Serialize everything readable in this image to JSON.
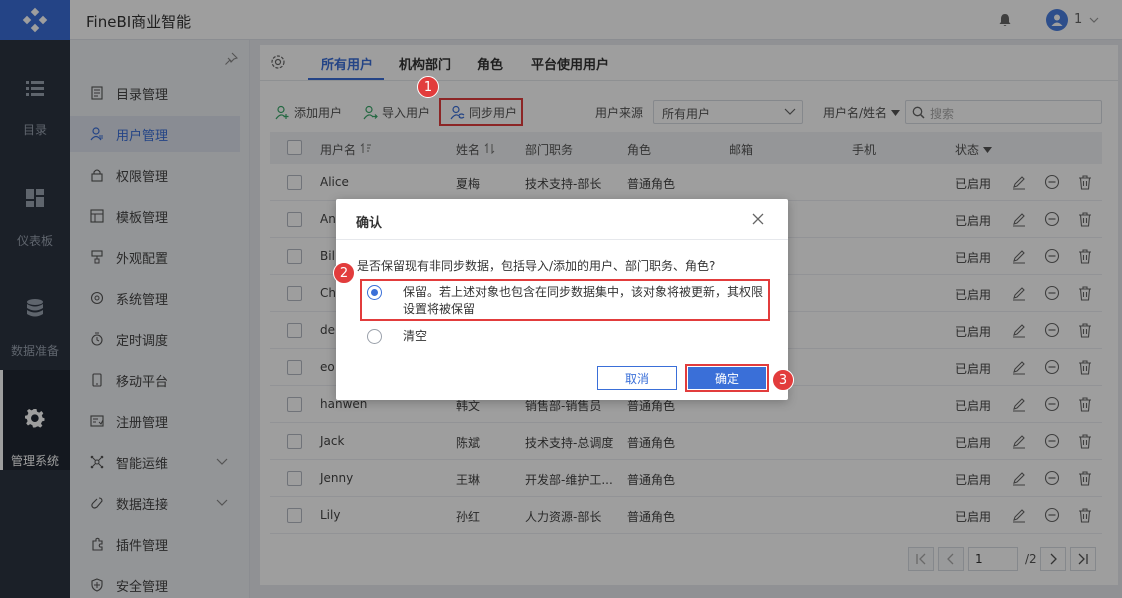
{
  "app": {
    "title": "FineBI商业智能",
    "user_name": "1"
  },
  "rail": [
    {
      "label": "目录",
      "icon": "list-icon"
    },
    {
      "label": "仪表板",
      "icon": "dashboard-icon"
    },
    {
      "label": "数据准备",
      "icon": "database-icon"
    },
    {
      "label": "管理系统",
      "icon": "gear-icon",
      "active": true
    }
  ],
  "menu": [
    {
      "label": "目录管理"
    },
    {
      "label": "用户管理",
      "active": true
    },
    {
      "label": "权限管理"
    },
    {
      "label": "模板管理"
    },
    {
      "label": "外观配置"
    },
    {
      "label": "系统管理"
    },
    {
      "label": "定时调度"
    },
    {
      "label": "移动平台"
    },
    {
      "label": "注册管理"
    },
    {
      "label": "智能运维",
      "expandable": true
    },
    {
      "label": "数据连接",
      "expandable": true
    },
    {
      "label": "插件管理"
    },
    {
      "label": "安全管理"
    }
  ],
  "tabs": [
    "所有用户",
    "机构部门",
    "角色",
    "平台使用用户"
  ],
  "toolbar": {
    "add_user": "添加用户",
    "import_user": "导入用户",
    "sync_user": "同步用户",
    "source_label": "用户来源",
    "source_value": "所有用户",
    "search_field": "用户名/姓名",
    "search_placeholder": "搜索"
  },
  "table": {
    "headers": {
      "username": "用户名",
      "name": "姓名",
      "dept": "部门职务",
      "role": "角色",
      "email": "邮箱",
      "phone": "手机",
      "status": "状态"
    },
    "rows": [
      {
        "username": "Alice",
        "name": "夏梅",
        "dept": "技术支持-部长",
        "role": "普通角色",
        "status": "已启用"
      },
      {
        "username": "An",
        "name": "",
        "dept": "",
        "role": "",
        "status": "已启用"
      },
      {
        "username": "Bill",
        "name": "",
        "dept": "",
        "role": "",
        "status": "已启用"
      },
      {
        "username": "Ch",
        "name": "",
        "dept": "",
        "role": "",
        "status": "已启用"
      },
      {
        "username": "der",
        "name": "",
        "dept": "",
        "role": "",
        "status": "已启用"
      },
      {
        "username": "eo",
        "name": "",
        "dept": "",
        "role": "",
        "status": "已启用"
      },
      {
        "username": "hanwen",
        "name": "韩文",
        "dept": "销售部-销售员",
        "role": "普通角色",
        "status": "已启用"
      },
      {
        "username": "Jack",
        "name": "陈斌",
        "dept": "技术支持-总调度",
        "role": "普通角色",
        "status": "已启用"
      },
      {
        "username": "Jenny",
        "name": "王琳",
        "dept": "开发部-维护工...",
        "role": "普通角色",
        "status": "已启用"
      },
      {
        "username": "Lily",
        "name": "孙红",
        "dept": "人力资源-部长",
        "role": "普通角色",
        "status": "已启用"
      }
    ]
  },
  "pager": {
    "current": "1",
    "total": "/2"
  },
  "dialog": {
    "title": "确认",
    "question": "是否保留现有非同步数据，包括导入/添加的用户、部门职务、角色?",
    "option_keep_line1": "保留。若上述对象也包含在同步数据集中，该对象将被更新，其权限",
    "option_keep_line2": "设置将被保留",
    "option_clear": "清空",
    "cancel": "取消",
    "ok": "确定"
  },
  "badges": [
    "1",
    "2",
    "3"
  ],
  "colors": {
    "accent": "#3a6fd8",
    "highlight": "#e23c3c",
    "rail_bg": "#2c3441"
  }
}
